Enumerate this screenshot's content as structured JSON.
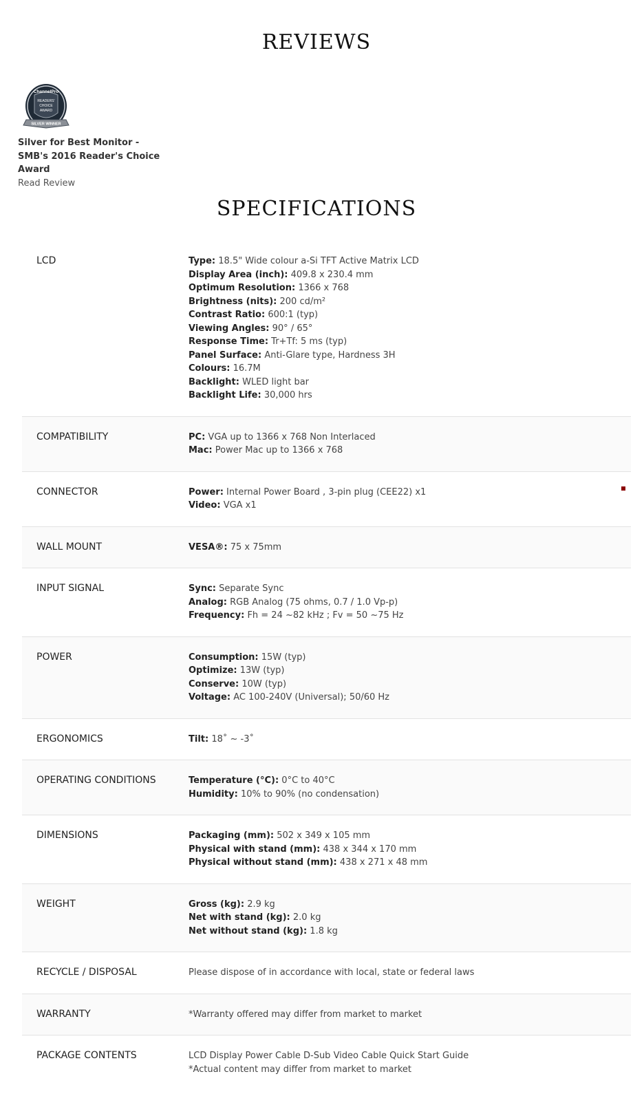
{
  "reviews": {
    "title": "REVIEWS",
    "award_title": "Silver for Best Monitor - SMB's 2016 Reader's Choice Award",
    "read_link": "Read Review",
    "badge": {
      "brand": "ChannelPro",
      "line1": "READERS'",
      "line2": "CHOICE",
      "line3": "AWARD",
      "ribbon": "SILVER WINNER"
    }
  },
  "specifications": {
    "title": "SPECIFICATIONS",
    "rows": [
      {
        "label": "LCD",
        "items": [
          {
            "k": "Type:",
            "v": "18.5\" Wide colour a-Si TFT Active Matrix LCD"
          },
          {
            "k": "Display Area (inch):",
            "v": "409.8 x 230.4 mm"
          },
          {
            "k": "Optimum Resolution:",
            "v": "1366 x 768"
          },
          {
            "k": "Brightness (nits):",
            "v": "200 cd/m²"
          },
          {
            "k": "Contrast Ratio:",
            "v": "600:1 (typ)"
          },
          {
            "k": "Viewing Angles:",
            "v": "90° / 65°"
          },
          {
            "k": "Response Time:",
            "v": "Tr+Tf: 5 ms (typ)"
          },
          {
            "k": "Panel Surface:",
            "v": "Anti-Glare type, Hardness 3H"
          },
          {
            "k": "Colours:",
            "v": "16.7M"
          },
          {
            "k": "Backlight:",
            "v": "WLED light bar"
          },
          {
            "k": "Backlight Life:",
            "v": "30,000 hrs"
          }
        ]
      },
      {
        "label": "COMPATIBILITY",
        "items": [
          {
            "k": "PC:",
            "v": "VGA up to 1366 x 768 Non Interlaced"
          },
          {
            "k": "Mac:",
            "v": "Power Mac up to 1366 x 768"
          }
        ]
      },
      {
        "label": "CONNECTOR",
        "items": [
          {
            "k": "Power:",
            "v": "Internal Power Board , 3-pin plug (CEE22) x1"
          },
          {
            "k": "Video:",
            "v": "VGA x1"
          }
        ]
      },
      {
        "label": "WALL MOUNT",
        "items": [
          {
            "k": "VESA®:",
            "v": "75 x 75mm"
          }
        ]
      },
      {
        "label": "INPUT SIGNAL",
        "items": [
          {
            "k": "Sync:",
            "v": "Separate Sync"
          },
          {
            "k": "Analog:",
            "v": "RGB Analog (75 ohms, 0.7 / 1.0 Vp-p)"
          },
          {
            "k": "Frequency:",
            "v": "Fh = 24 ~82 kHz ; Fv = 50 ~75 Hz"
          }
        ]
      },
      {
        "label": "POWER",
        "items": [
          {
            "k": "Consumption:",
            "v": "15W (typ)"
          },
          {
            "k": "Optimize:",
            "v": "13W (typ)"
          },
          {
            "k": "Conserve:",
            "v": "10W (typ)"
          },
          {
            "k": "Voltage:",
            "v": "AC 100-240V (Universal); 50/60 Hz"
          }
        ]
      },
      {
        "label": "ERGONOMICS",
        "items": [
          {
            "k": "Tilt:",
            "v": "18˚ ~ -3˚"
          }
        ]
      },
      {
        "label": "OPERATING CONDITIONS",
        "items": [
          {
            "k": "Temperature (°C):",
            "v": "0°C to 40°C"
          },
          {
            "k": "Humidity:",
            "v": "10% to 90% (no condensation)"
          }
        ]
      },
      {
        "label": "DIMENSIONS",
        "items": [
          {
            "k": "Packaging (mm):",
            "v": "502 x 349 x 105 mm"
          },
          {
            "k": "Physical with stand (mm):",
            "v": "438 x 344 x 170 mm"
          },
          {
            "k": "Physical without stand (mm):",
            "v": "438 x 271 x 48 mm"
          }
        ]
      },
      {
        "label": "WEIGHT",
        "items": [
          {
            "k": "Gross (kg):",
            "v": "2.9 kg"
          },
          {
            "k": "Net with stand (kg):",
            "v": "2.0 kg"
          },
          {
            "k": "Net without stand (kg):",
            "v": "1.8 kg"
          }
        ]
      },
      {
        "label": "RECYCLE / DISPOSAL",
        "items": [
          {
            "k": "",
            "v": "Please dispose of in accordance with local, state or federal laws"
          }
        ]
      },
      {
        "label": "WARRANTY",
        "items": [
          {
            "k": "",
            "v": "*Warranty offered may differ from market to market"
          }
        ]
      },
      {
        "label": "PACKAGE CONTENTS",
        "items": [
          {
            "k": "",
            "v": "LCD Display Power Cable D-Sub Video Cable Quick Start Guide"
          },
          {
            "k": "",
            "v": "*Actual content may differ from market to market"
          }
        ]
      }
    ]
  },
  "colors": {
    "marker": "#8b0000",
    "badge_shield": "#2a3340",
    "badge_ribbon": "#8a8f96"
  }
}
